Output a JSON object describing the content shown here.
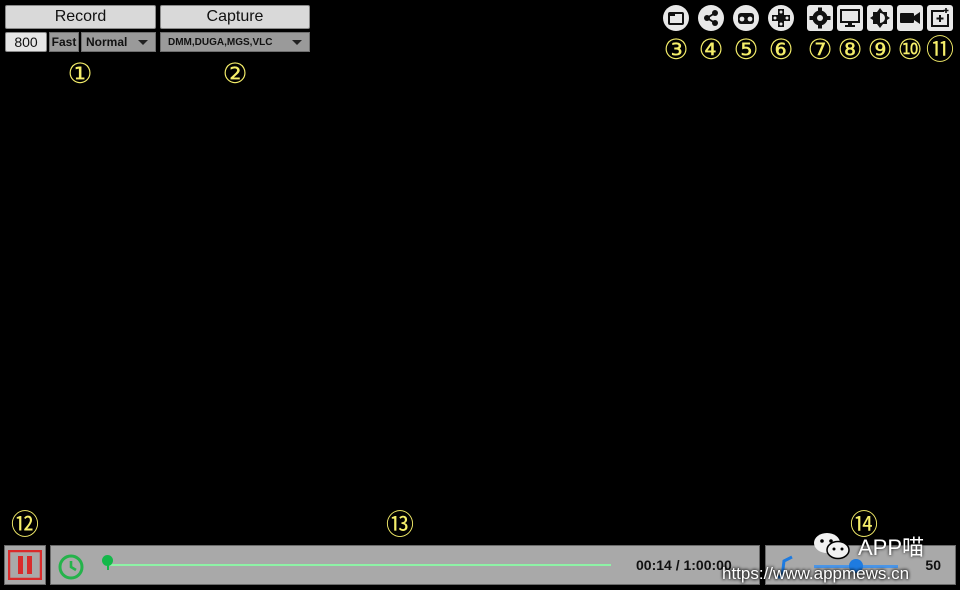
{
  "left_controls": {
    "record_label": "Record",
    "capture_label": "Capture",
    "bitrate_value": "800",
    "fast_label": "Fast",
    "speed_selected": "Normal",
    "source_selected": "DMM,DUGA,MGS,VLC"
  },
  "toolbar_icons": [
    "folder-icon",
    "share-icon",
    "vr-headset-icon",
    "gamepad-icon",
    "settings-icon",
    "monitor-icon",
    "brightness-icon",
    "video-camera-icon",
    "add-screen-icon"
  ],
  "callouts": {
    "n1": "①",
    "n2": "②",
    "n3": "③",
    "n4": "④",
    "n5": "⑤",
    "n6": "⑥",
    "n7": "⑦",
    "n8": "⑧",
    "n9": "⑨",
    "n10": "⑩",
    "n11": "⑪",
    "n12": "⑫",
    "n13": "⑬",
    "n14": "⑭"
  },
  "playback": {
    "time_display": "00:14 / 1:00:00",
    "progress": 0.0039,
    "volume_value": "50",
    "volume_level": 0.5
  },
  "watermark": {
    "title": "APP喵",
    "url": "https://www.appmews.cn"
  },
  "colors": {
    "callout": "#f6ef6a",
    "pause_button": "#d92b2b",
    "clock_icon": "#25b34b",
    "progress_track": "#8ef2a6",
    "volume_accent": "#1e7be0"
  }
}
